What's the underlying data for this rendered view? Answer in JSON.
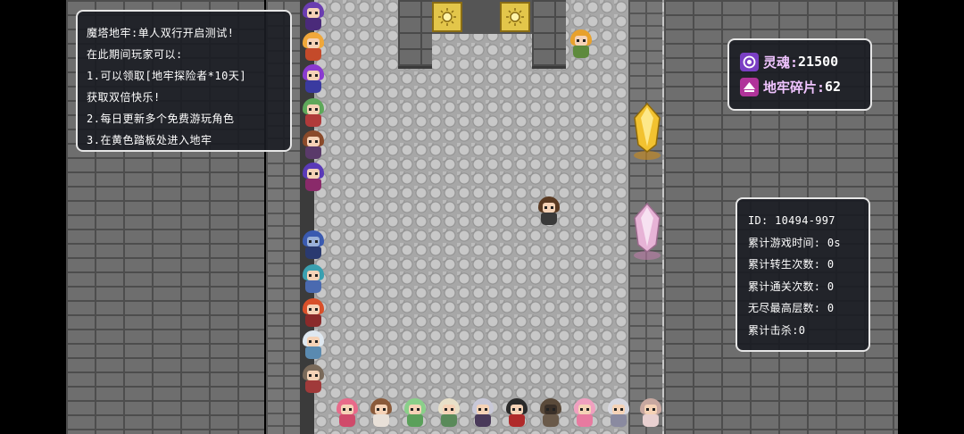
{
  "info": {
    "lines": [
      "魔塔地牢:单人双行开启测试!",
      "在此期间玩家可以:",
      "1.可以领取[地牢探险者*10天]",
      "获取双倍快乐!",
      "2.每日更新多个免费游玩角色",
      "3.在黄色踏板处进入地牢"
    ]
  },
  "resources": {
    "soul": {
      "label": "灵魂:",
      "value": "21500",
      "icon": "soul-orb-icon",
      "color": "#7a3fc4"
    },
    "shard": {
      "label": "地牢碎片:",
      "value": "62",
      "icon": "dungeon-shard-icon",
      "color": "#b0339a"
    }
  },
  "stats": {
    "id": "ID: 10494-997",
    "play_time": "累计游戏时间: 0s",
    "rebirth": "累计转生次数: 0",
    "clears": "累计通关次数: 0",
    "endless_floor": "无尽最高层数: 0",
    "kills": "累计击杀:0"
  },
  "colors": {
    "plate": "#e3c64a",
    "gold_crystal": "#f2c230",
    "pink_crystal": "#e7b3d6"
  }
}
